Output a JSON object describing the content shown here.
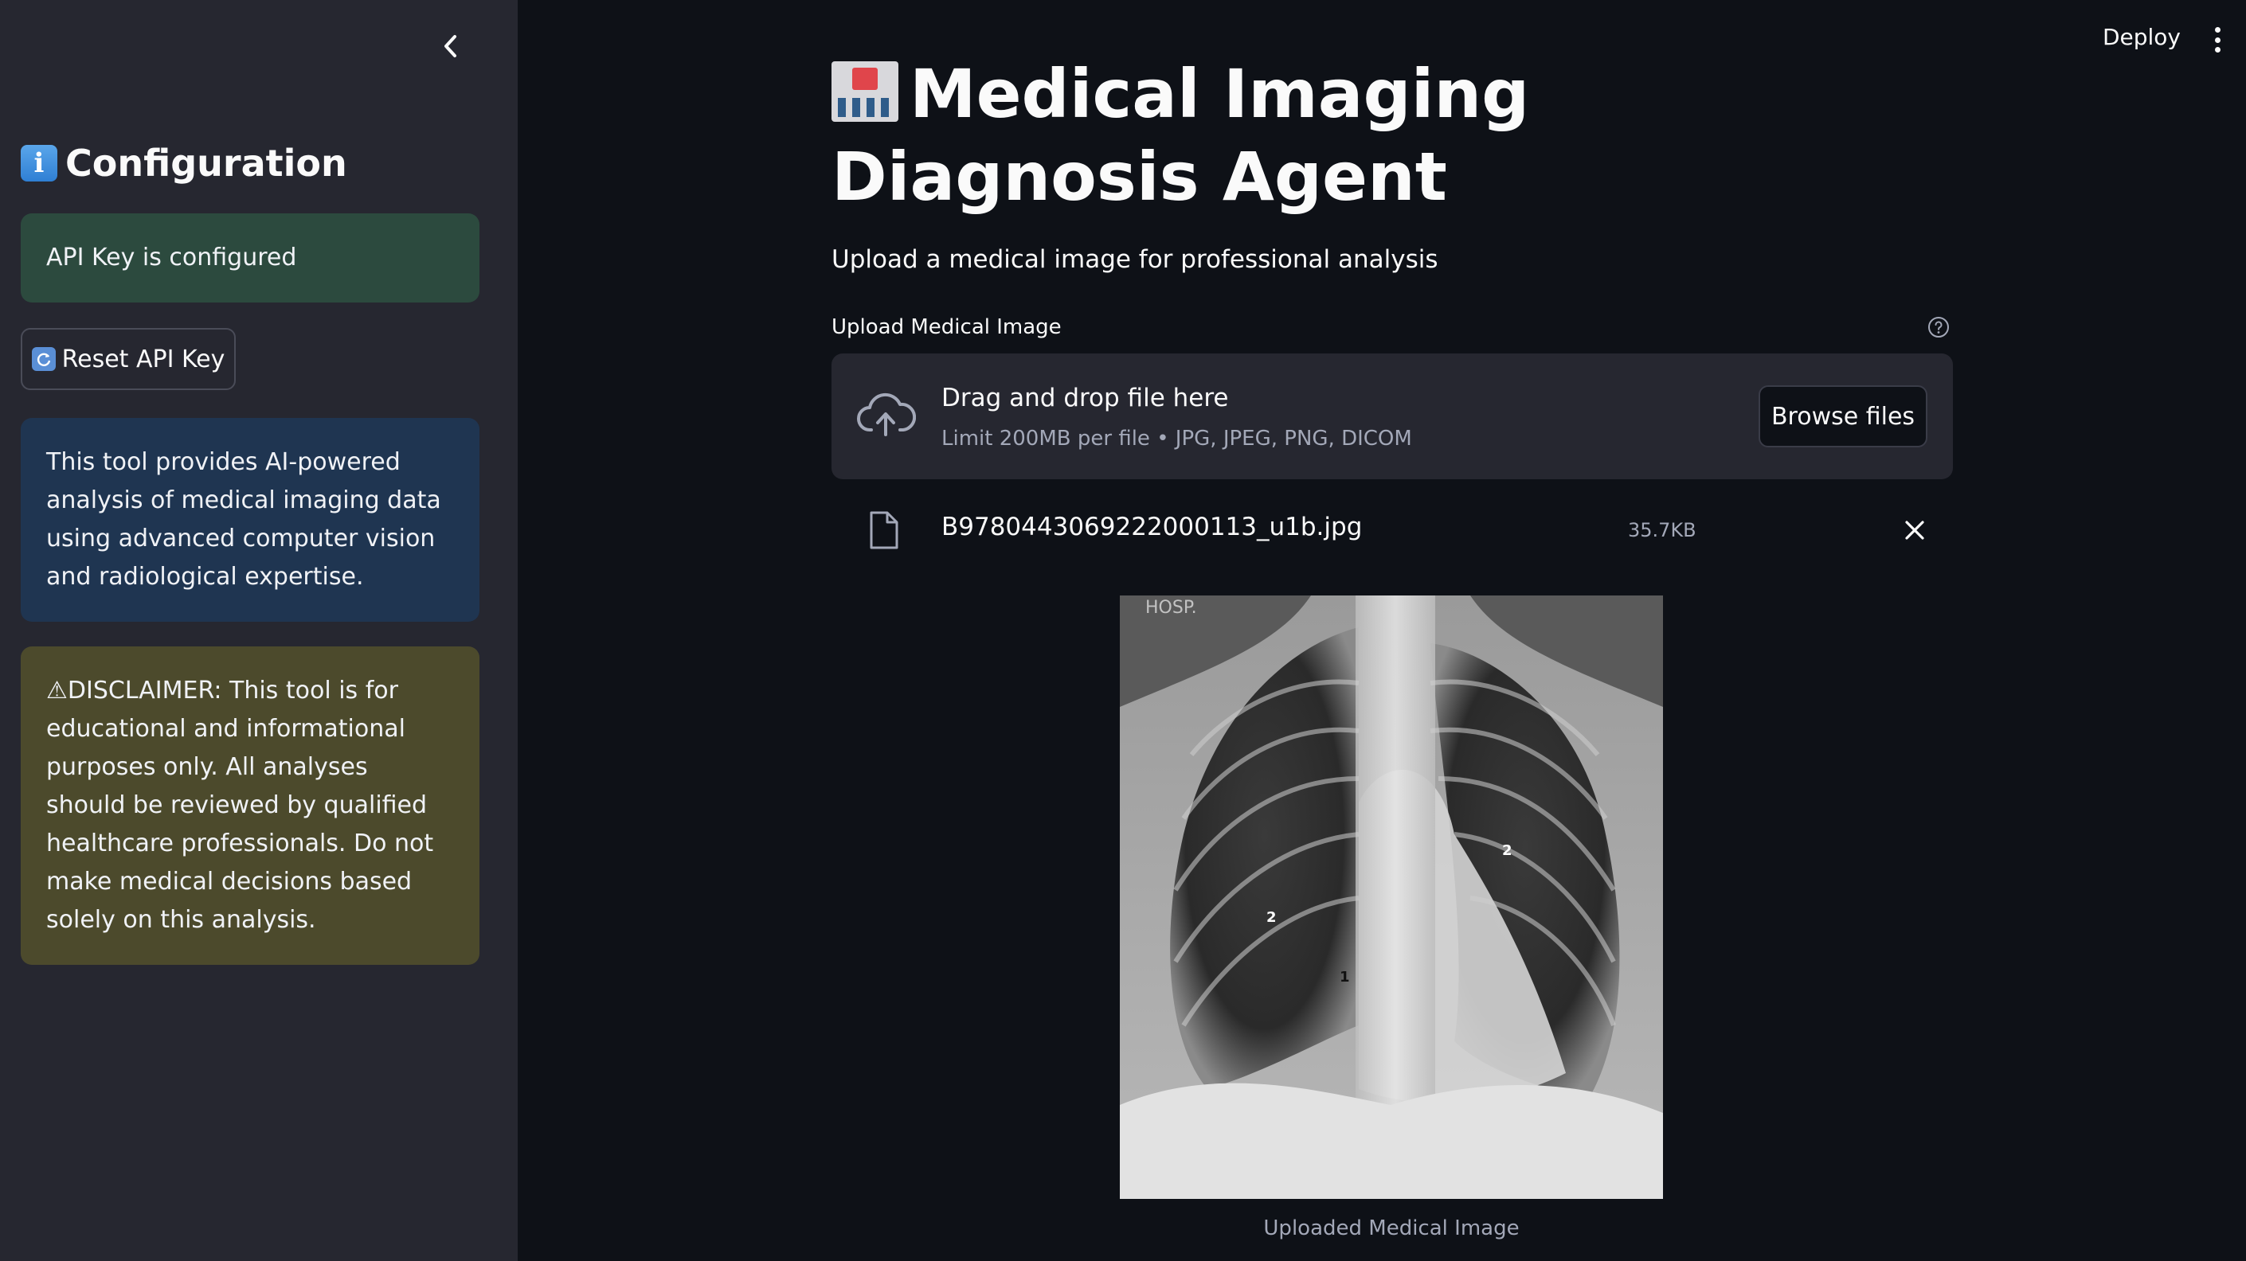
{
  "sidebar": {
    "collapse_icon": "chevron-left-icon",
    "heading": "Configuration",
    "heading_icon": "info-icon",
    "api_status": "API Key is configured",
    "reset_button": "Reset API Key",
    "reset_icon": "refresh-icon",
    "info_text": "This tool provides AI-powered analysis of medical imaging data using advanced computer vision and radiological expertise.",
    "disclaimer_text": "⚠DISCLAIMER: This tool is for educational and informational purposes only. All analyses should be reviewed by qualified healthcare professionals. Do not make medical decisions based solely on this analysis."
  },
  "topbar": {
    "deploy": "Deploy",
    "menu_icon": "kebab-menu-icon"
  },
  "main": {
    "title": "Medical Imaging Diagnosis Agent",
    "title_icon": "hospital-icon",
    "subtitle": "Upload a medical image for professional analysis",
    "uploader": {
      "label": "Upload Medical Image",
      "help_icon": "question-circle-icon",
      "drop_title": "Drag and drop file here",
      "drop_limit": "Limit 200MB per file • JPG, JPEG, PNG, DICOM",
      "browse_button": "Browse files"
    },
    "uploaded_file": {
      "name": "B9780443069222000113_u1b.jpg",
      "size": "35.7KB"
    },
    "image": {
      "watermark": "HOSP.",
      "markers": [
        "1",
        "2",
        "2"
      ],
      "caption": "Uploaded Medical Image"
    }
  },
  "colors": {
    "app_bg": "#0e1117",
    "sidebar_bg": "#262730",
    "success_bg": "#2c4a3e",
    "info_bg": "#1f3551",
    "warning_bg": "#4c4a2c"
  }
}
